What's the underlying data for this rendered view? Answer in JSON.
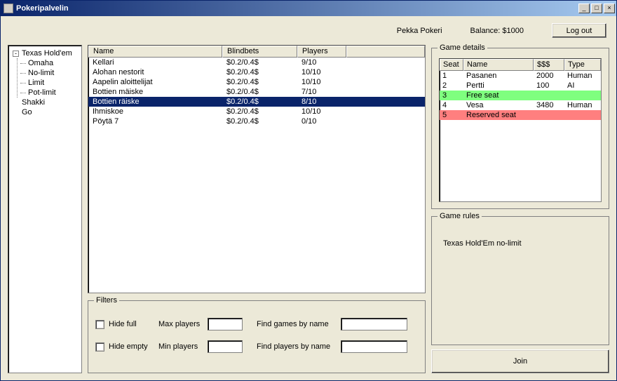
{
  "window": {
    "title": "Pokeripalvelin"
  },
  "topbar": {
    "username": "Pekka Pokeri",
    "balance_label": "Balance: $1000",
    "logout": "Log out"
  },
  "tree": {
    "root": {
      "label": "Texas Hold'em",
      "children": [
        {
          "label": "Omaha"
        },
        {
          "label": "No-limit"
        },
        {
          "label": "Limit"
        },
        {
          "label": "Pot-limit"
        }
      ]
    },
    "siblings": [
      {
        "label": "Shakki"
      },
      {
        "label": "Go"
      }
    ]
  },
  "games": {
    "headers": {
      "name": "Name",
      "blindbets": "Blindbets",
      "players": "Players"
    },
    "rows": [
      {
        "name": "Kellari",
        "blind": "$0.2/0.4$",
        "players": "9/10"
      },
      {
        "name": "Alohan nestorit",
        "blind": "$0.2/0.4$",
        "players": "10/10"
      },
      {
        "name": "Aapelin aloittelijat",
        "blind": "$0.2/0.4$",
        "players": "10/10"
      },
      {
        "name": "Bottien mäiske",
        "blind": "$0.2/0.4$",
        "players": "7/10"
      },
      {
        "name": "Bottien räiske",
        "blind": "$0.2/0.4$",
        "players": "8/10"
      },
      {
        "name": "Ihmiskoe",
        "blind": "$0.2/0.4$",
        "players": "10/10"
      },
      {
        "name": "Pöytä 7",
        "blind": "$0.2/0.4$",
        "players": "0/10"
      }
    ],
    "selected_index": 4
  },
  "filters": {
    "legend": "Filters",
    "hide_full": "Hide full",
    "hide_empty": "Hide empty",
    "max_players": "Max players",
    "min_players": "Min players",
    "find_games": "Find games by name",
    "find_players": "Find players by name"
  },
  "details": {
    "legend": "Game details",
    "headers": {
      "seat": "Seat",
      "name": "Name",
      "money": "$$$",
      "type": "Type"
    },
    "rows": [
      {
        "seat": "1",
        "name": "Pasanen",
        "money": "2000",
        "type": "Human",
        "status": ""
      },
      {
        "seat": "2",
        "name": "Pertti",
        "money": "100",
        "type": "AI",
        "status": ""
      },
      {
        "seat": "3",
        "name": "Free seat",
        "money": "",
        "type": "",
        "status": "free"
      },
      {
        "seat": "4",
        "name": "Vesa",
        "money": "3480",
        "type": "Human",
        "status": ""
      },
      {
        "seat": "5",
        "name": "Reserved seat",
        "money": "",
        "type": "",
        "status": "reserved"
      }
    ]
  },
  "rules": {
    "legend": "Game rules",
    "text": "Texas Hold'Em no-limit"
  },
  "join": {
    "label": "Join"
  }
}
